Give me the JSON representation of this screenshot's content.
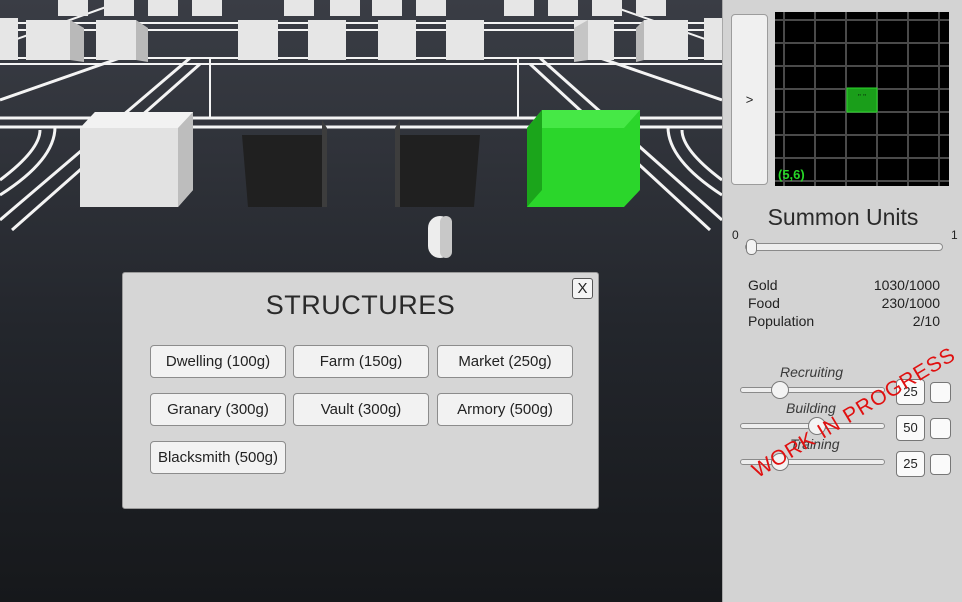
{
  "structures": {
    "title": "STRUCTURES",
    "close_label": "X",
    "buttons": [
      "Dwelling (100g)",
      "Farm (150g)",
      "Market (250g)",
      "Granary (300g)",
      "Vault (300g)",
      "Armory (500g)",
      "Blacksmith (500g)"
    ]
  },
  "panel": {
    "toggle_label": ">",
    "minimap": {
      "coord": "(5,6)",
      "unit_mark": "\" \""
    },
    "summon": {
      "title": "Summon Units",
      "min": "0",
      "max": "1",
      "value": 0
    },
    "resources": [
      {
        "label": "Gold",
        "value": "1030/1000"
      },
      {
        "label": "Food",
        "value": "230/1000"
      },
      {
        "label": "Population",
        "value": "2/10"
      }
    ],
    "allocations": [
      {
        "label": "Recruiting",
        "value": "25",
        "fraction": 0.25
      },
      {
        "label": "Building",
        "value": "50",
        "fraction": 0.5
      },
      {
        "label": "Training",
        "value": "25",
        "fraction": 0.25
      }
    ],
    "watermark": "WORK IN PROGRESS"
  },
  "colors": {
    "accent_green": "#2bd62b",
    "panel_bg": "#d3d3d3",
    "watermark": "#e01010"
  }
}
